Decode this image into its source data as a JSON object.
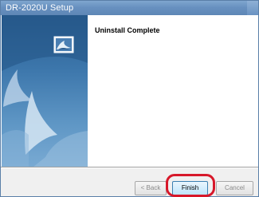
{
  "window": {
    "title": "DR-2020U Setup"
  },
  "content": {
    "heading": "Uninstall Complete"
  },
  "buttons": {
    "back": "< Back",
    "finish": "Finish",
    "cancel": "Cancel"
  },
  "colors": {
    "titlebar": "#6891c0",
    "banner": "#3c76ab",
    "highlight": "#d7182a",
    "footer": "#f0f0f0"
  },
  "icons": {
    "product": "installer-package-icon"
  }
}
